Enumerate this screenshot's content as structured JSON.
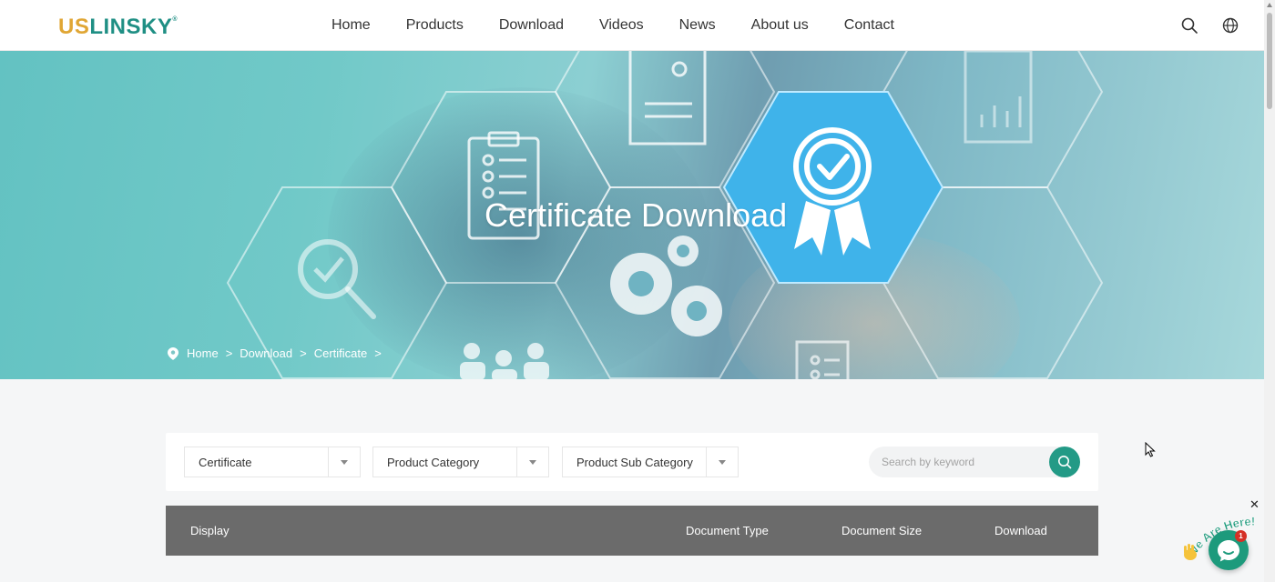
{
  "header": {
    "logo_us": "US",
    "logo_rest": "LINSKY",
    "logo_mark": "®",
    "nav": [
      {
        "label": "Home"
      },
      {
        "label": "Products"
      },
      {
        "label": "Download"
      },
      {
        "label": "Videos"
      },
      {
        "label": "News"
      },
      {
        "label": "About us"
      },
      {
        "label": "Contact"
      }
    ],
    "icons": [
      "search-icon",
      "globe-icon"
    ]
  },
  "banner": {
    "title": "Certificate Download",
    "breadcrumb": [
      {
        "label": "Home"
      },
      {
        "label": "Download"
      },
      {
        "label": "Certificate"
      }
    ],
    "separator": ">"
  },
  "filters": {
    "selects": [
      {
        "value": "Certificate"
      },
      {
        "value": "Product Category"
      },
      {
        "value": "Product Sub Category"
      }
    ],
    "search_placeholder": "Search by keyword"
  },
  "table": {
    "columns": [
      "Display",
      "Document Type",
      "Document Size",
      "Download"
    ]
  },
  "chat": {
    "wave_text": "We Are Here!",
    "badge_count": "1",
    "close": "✕"
  },
  "colors": {
    "brand_teal": "#1f8f84",
    "brand_gold": "#e0a634",
    "search_button": "#239a86",
    "table_header": "#6b6b6b",
    "chat_button": "#1d9a7c",
    "badge": "#d52f25"
  }
}
